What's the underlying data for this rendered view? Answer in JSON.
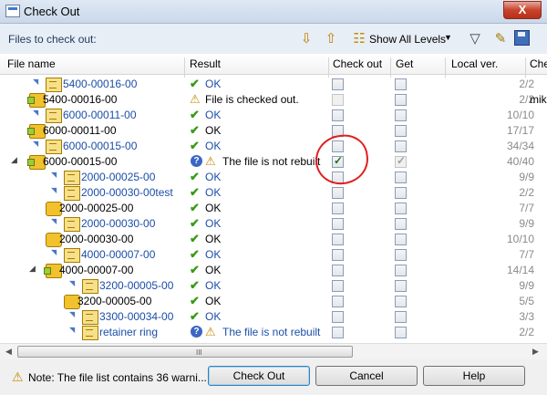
{
  "window": {
    "title": "Check Out",
    "close_symbol": "X"
  },
  "toolbar": {
    "files_label": "Files to check out:",
    "levels_label": "Show All Levels",
    "caret": "▼"
  },
  "columns": {
    "file_name": "File name",
    "result": "Result",
    "check_out": "Check out",
    "get": "Get",
    "local_ver": "Local ver.",
    "extra": "Chec"
  },
  "rows": [
    {
      "name": "5400-00016-00",
      "link": true,
      "icon": "part",
      "result": "OK",
      "result_link": true,
      "mark": "ok",
      "co": false,
      "co_dis": false,
      "get": false,
      "ver": "2/2",
      "extra": ""
    },
    {
      "name": "5400-00016-00",
      "link": false,
      "icon": "asm",
      "result": "File is checked out.",
      "result_link": false,
      "mark": "warn",
      "co": false,
      "co_dis": true,
      "get": false,
      "ver": "2/2",
      "extra": "mike"
    },
    {
      "name": "6000-00011-00",
      "link": true,
      "icon": "part",
      "result": "OK",
      "result_link": true,
      "mark": "ok",
      "co": false,
      "co_dis": false,
      "get": false,
      "ver": "10/10",
      "extra": ""
    },
    {
      "name": "6000-00011-00",
      "link": false,
      "icon": "asm",
      "result": "OK",
      "result_link": false,
      "mark": "ok",
      "co": false,
      "co_dis": false,
      "get": false,
      "ver": "17/17",
      "extra": ""
    },
    {
      "name": "6000-00015-00",
      "link": true,
      "icon": "part",
      "result": "OK",
      "result_link": true,
      "mark": "ok",
      "co": false,
      "co_dis": false,
      "get": false,
      "ver": "34/34",
      "extra": ""
    },
    {
      "name": "6000-00015-00",
      "link": false,
      "icon": "asm",
      "result": "The file is not rebuilt",
      "result_link": false,
      "mark": "qwarn",
      "co": true,
      "co_dis": false,
      "get": true,
      "get_dis": true,
      "ver": "40/40",
      "extra": ""
    },
    {
      "name": "2000-00025-00",
      "link": true,
      "icon": "part",
      "result": "OK",
      "result_link": true,
      "mark": "ok",
      "co": false,
      "co_dis": false,
      "get": false,
      "ver": "9/9",
      "extra": ""
    },
    {
      "name": "2000-00030-00test",
      "link": true,
      "icon": "part",
      "result": "OK",
      "result_link": true,
      "mark": "ok",
      "co": false,
      "co_dis": false,
      "get": false,
      "ver": "2/2",
      "extra": ""
    },
    {
      "name": "2000-00025-00",
      "link": false,
      "icon": "yel",
      "result": "OK",
      "result_link": false,
      "mark": "ok",
      "co": false,
      "co_dis": false,
      "get": false,
      "ver": "7/7",
      "extra": ""
    },
    {
      "name": "2000-00030-00",
      "link": true,
      "icon": "part",
      "result": "OK",
      "result_link": true,
      "mark": "ok",
      "co": false,
      "co_dis": false,
      "get": false,
      "ver": "9/9",
      "extra": ""
    },
    {
      "name": "2000-00030-00",
      "link": false,
      "icon": "yel",
      "result": "OK",
      "result_link": false,
      "mark": "ok",
      "co": false,
      "co_dis": false,
      "get": false,
      "ver": "10/10",
      "extra": ""
    },
    {
      "name": "4000-00007-00",
      "link": true,
      "icon": "part",
      "result": "OK",
      "result_link": true,
      "mark": "ok",
      "co": false,
      "co_dis": false,
      "get": false,
      "ver": "7/7",
      "extra": ""
    },
    {
      "name": "4000-00007-00",
      "link": false,
      "icon": "asm",
      "result": "OK",
      "result_link": false,
      "mark": "ok",
      "co": false,
      "co_dis": false,
      "get": false,
      "ver": "14/14",
      "extra": ""
    },
    {
      "name": "3200-00005-00",
      "link": true,
      "icon": "part",
      "result": "OK",
      "result_link": true,
      "mark": "ok",
      "co": false,
      "co_dis": false,
      "get": false,
      "ver": "9/9",
      "extra": ""
    },
    {
      "name": "3200-00005-00",
      "link": false,
      "icon": "yel",
      "result": "OK",
      "result_link": false,
      "mark": "ok",
      "co": false,
      "co_dis": false,
      "get": false,
      "ver": "5/5",
      "extra": ""
    },
    {
      "name": "3300-00034-00",
      "link": true,
      "icon": "part",
      "result": "OK",
      "result_link": true,
      "mark": "ok",
      "co": false,
      "co_dis": false,
      "get": false,
      "ver": "3/3",
      "extra": ""
    },
    {
      "name": "retainer ring",
      "link": true,
      "icon": "part",
      "result": "The file is not rebuilt",
      "result_link": true,
      "mark": "qwarn",
      "co": false,
      "co_dis": false,
      "get": false,
      "ver": "2/2",
      "extra": ""
    }
  ],
  "footer": {
    "note": "Note: The file list contains 36 warni...",
    "checkout_label": "Check Out",
    "cancel_label": "Cancel",
    "help_label": "Help"
  },
  "scroll_grip": "III"
}
